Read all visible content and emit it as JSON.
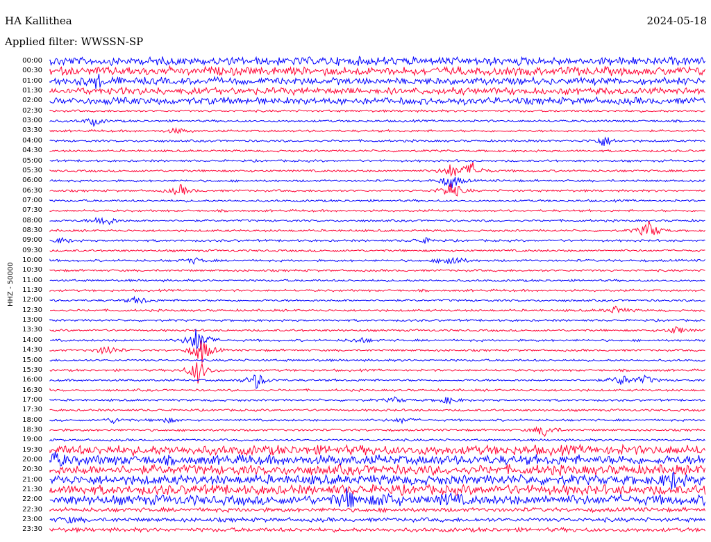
{
  "header": {
    "station": "HA Kallithea",
    "date": "2024-05-18",
    "filter": "Applied filter: WWSSN-SP",
    "channel": "HHZ - 50000"
  },
  "colors": {
    "odd": "#0000ff",
    "even": "#ff0033"
  },
  "rows": [
    {
      "label": "00:00",
      "color": "#0000ff"
    },
    {
      "label": "00:30",
      "color": "#ff0033"
    },
    {
      "label": "01:00",
      "color": "#0000ff"
    },
    {
      "label": "01:30",
      "color": "#ff0033"
    },
    {
      "label": "02:00",
      "color": "#0000ff"
    },
    {
      "label": "02:30",
      "color": "#ff0033"
    },
    {
      "label": "03:00",
      "color": "#0000ff"
    },
    {
      "label": "03:30",
      "color": "#ff0033"
    },
    {
      "label": "04:00",
      "color": "#0000ff"
    },
    {
      "label": "04:30",
      "color": "#ff0033"
    },
    {
      "label": "05:00",
      "color": "#0000ff"
    },
    {
      "label": "05:30",
      "color": "#ff0033"
    },
    {
      "label": "06:00",
      "color": "#0000ff"
    },
    {
      "label": "06:30",
      "color": "#ff0033"
    },
    {
      "label": "07:00",
      "color": "#0000ff"
    },
    {
      "label": "07:30",
      "color": "#ff0033"
    },
    {
      "label": "08:00",
      "color": "#0000ff"
    },
    {
      "label": "08:30",
      "color": "#ff0033"
    },
    {
      "label": "09:00",
      "color": "#0000ff"
    },
    {
      "label": "09:30",
      "color": "#ff0033"
    },
    {
      "label": "10:00",
      "color": "#0000ff"
    },
    {
      "label": "10:30",
      "color": "#ff0033"
    },
    {
      "label": "11:00",
      "color": "#0000ff"
    },
    {
      "label": "11:30",
      "color": "#ff0033"
    },
    {
      "label": "12:00",
      "color": "#0000ff"
    },
    {
      "label": "12:30",
      "color": "#ff0033"
    },
    {
      "label": "13:00",
      "color": "#0000ff"
    },
    {
      "label": "13:30",
      "color": "#ff0033"
    },
    {
      "label": "14:00",
      "color": "#0000ff"
    },
    {
      "label": "14:30",
      "color": "#ff0033"
    },
    {
      "label": "15:00",
      "color": "#0000ff"
    },
    {
      "label": "15:30",
      "color": "#ff0033"
    },
    {
      "label": "16:00",
      "color": "#0000ff"
    },
    {
      "label": "16:30",
      "color": "#ff0033"
    },
    {
      "label": "17:00",
      "color": "#0000ff"
    },
    {
      "label": "17:30",
      "color": "#ff0033"
    },
    {
      "label": "18:00",
      "color": "#0000ff"
    },
    {
      "label": "18:30",
      "color": "#ff0033"
    },
    {
      "label": "19:00",
      "color": "#0000ff"
    },
    {
      "label": "19:30",
      "color": "#ff0033"
    },
    {
      "label": "20:00",
      "color": "#0000ff"
    },
    {
      "label": "20:30",
      "color": "#ff0033"
    },
    {
      "label": "21:00",
      "color": "#0000ff"
    },
    {
      "label": "21:30",
      "color": "#ff0033"
    },
    {
      "label": "22:00",
      "color": "#0000ff"
    },
    {
      "label": "22:30",
      "color": "#ff0033"
    },
    {
      "label": "23:00",
      "color": "#0000ff"
    },
    {
      "label": "23:30",
      "color": "#ff0033"
    }
  ]
}
